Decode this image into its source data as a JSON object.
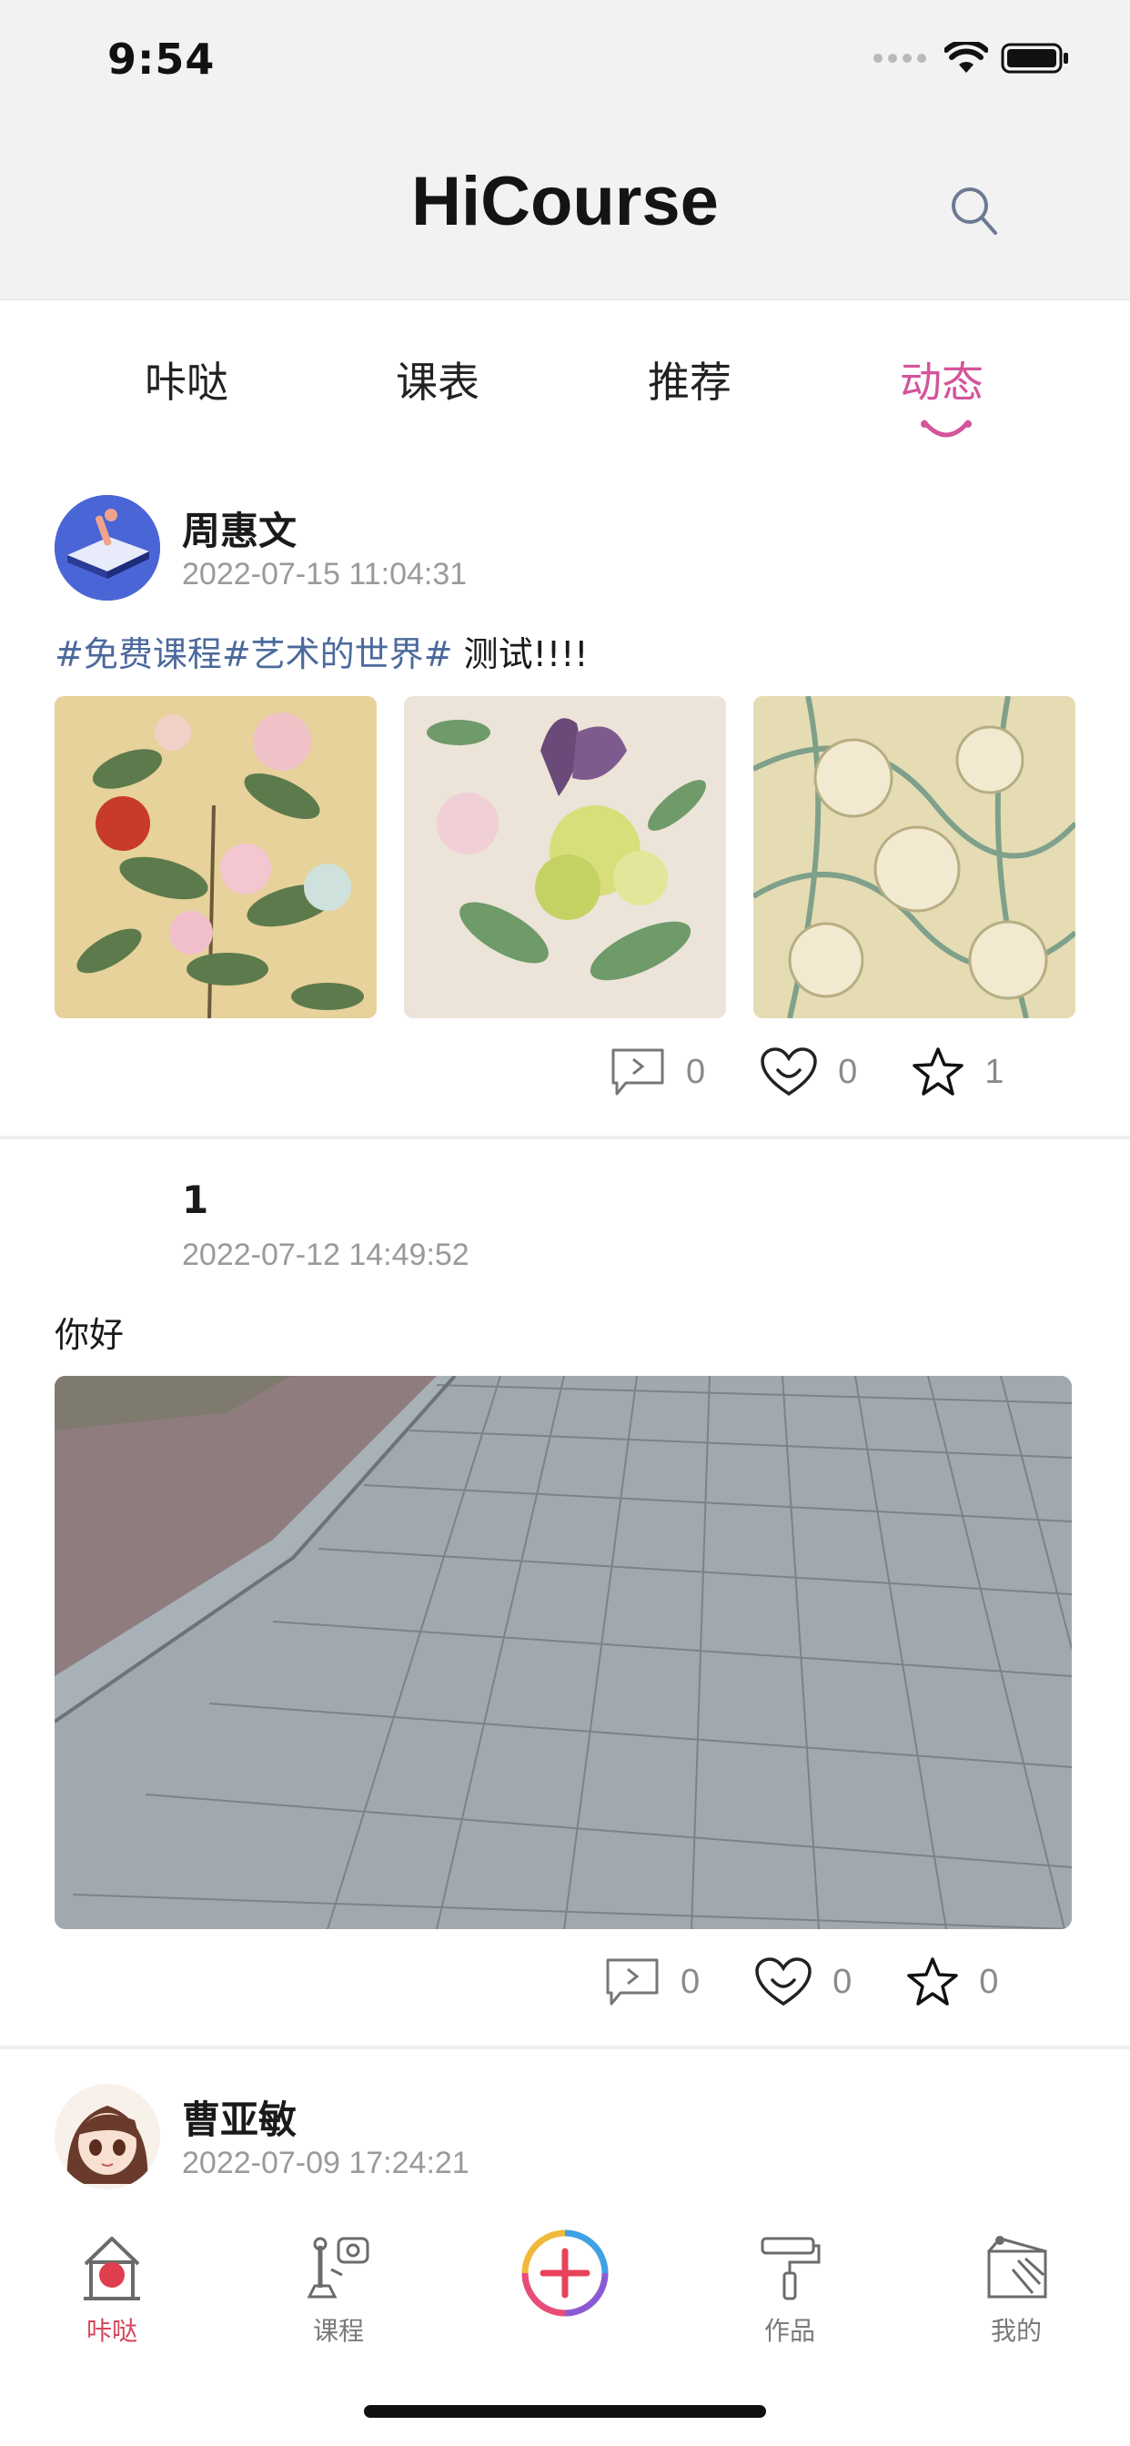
{
  "status_bar": {
    "time": "9:54"
  },
  "header": {
    "title": "HiCourse",
    "search_icon": "search-icon"
  },
  "tabs": [
    {
      "label": "咔哒",
      "active": false
    },
    {
      "label": "课表",
      "active": false
    },
    {
      "label": "推荐",
      "active": false
    },
    {
      "label": "动态",
      "active": true
    }
  ],
  "accent_color": "#d4549a",
  "posts": [
    {
      "author": "周惠文",
      "timestamp": "2022-07-15 11:04:31",
      "tags": "#免费课程#艺术的世界#",
      "text": " 测试!!!!",
      "images": [
        "peony-painting",
        "iris-flower-painting",
        "floral-pattern"
      ],
      "comments": "0",
      "likes": "0",
      "favorites": "1"
    },
    {
      "author": "1",
      "timestamp": "2022-07-12 14:49:52",
      "text": "你好",
      "images": [
        "paved-sidewalk-photo"
      ],
      "comments": "0",
      "likes": "0",
      "favorites": "0"
    },
    {
      "author": "曹亚敏",
      "timestamp": "2022-07-09 17:24:21"
    }
  ],
  "bottom_nav": [
    {
      "label": "咔哒",
      "icon": "home-icon",
      "active": true
    },
    {
      "label": "课程",
      "icon": "course-icon",
      "active": false
    },
    {
      "label": "",
      "icon": "add-icon",
      "active": false
    },
    {
      "label": "作品",
      "icon": "paint-roller-icon",
      "active": false
    },
    {
      "label": "我的",
      "icon": "profile-icon",
      "active": false
    }
  ]
}
